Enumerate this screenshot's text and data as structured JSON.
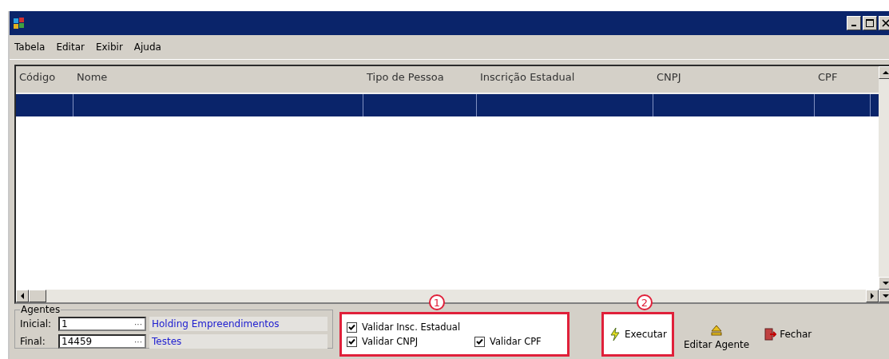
{
  "menu": [
    {
      "label": "Tabela"
    },
    {
      "label": "Editar"
    },
    {
      "label": "Exibir"
    },
    {
      "label": "Ajuda"
    }
  ],
  "table": {
    "columns": [
      "Código",
      "Nome",
      "Tipo de Pessoa",
      "Inscrição Estadual",
      "CNPJ",
      "CPF"
    ],
    "rows": [
      {
        "selected": true
      }
    ]
  },
  "agentes": {
    "title": "Agentes",
    "fields": [
      {
        "label": "Inicial:",
        "value": "1",
        "browse": "···",
        "name": "Holding Empreendimentos"
      },
      {
        "label": "Final:",
        "value": "14459",
        "browse": "···",
        "name": "Testes"
      }
    ]
  },
  "options": {
    "marker": "1",
    "checkboxes": [
      {
        "label": "Validar Insc. Estadual",
        "checked": true
      },
      {
        "label": "Validar CNPJ",
        "checked": true
      },
      {
        "label": "Validar CPF",
        "checked": true
      }
    ]
  },
  "actions": [
    {
      "label": "Executar",
      "kind": "execute",
      "marker": "2"
    },
    {
      "label": "Editar Agente",
      "kind": "edit"
    },
    {
      "label": "Fechar",
      "kind": "close"
    }
  ]
}
